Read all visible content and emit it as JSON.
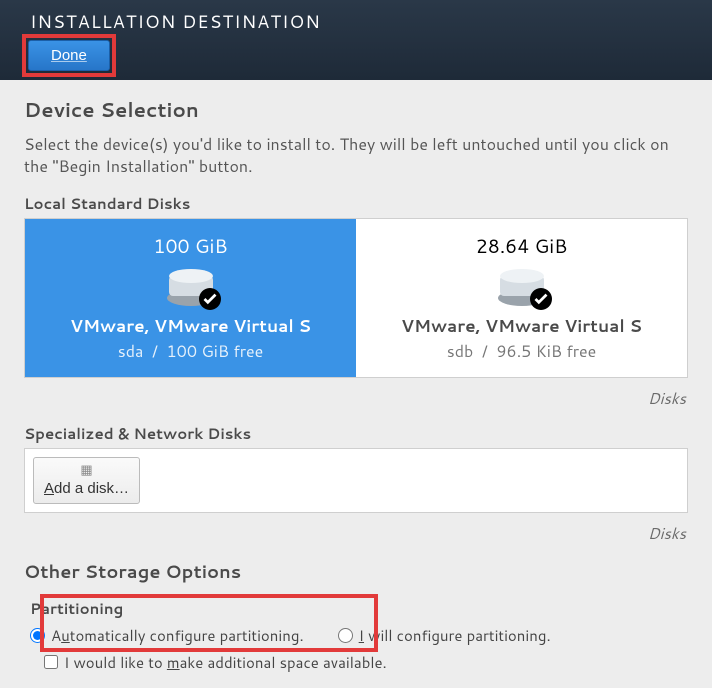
{
  "header": {
    "title": "INSTALLATION DESTINATION",
    "done_label": "Done"
  },
  "device_selection": {
    "title": "Device Selection",
    "instruction": "Select the device(s) you'd like to install to.  They will be left untouched until you click on the \"Begin Installation\" button.",
    "local_disks_label": "Local Standard Disks",
    "disks_note": "Disks",
    "disks": [
      {
        "size": "100 GiB",
        "label": "VMware, VMware Virtual S",
        "dev": "sda",
        "free": "100 GiB free",
        "selected": true
      },
      {
        "size": "28.64 GiB",
        "label": "VMware, VMware Virtual S",
        "dev": "sdb",
        "free": "96.5 KiB free",
        "selected": false
      }
    ],
    "specialized_label": "Specialized & Network Disks",
    "add_disk_label": "Add a disk…"
  },
  "other_storage": {
    "title": "Other Storage Options",
    "partitioning_label": "Partitioning",
    "auto_label": "Automatically configure partitioning.",
    "manual_label": "I will configure partitioning.",
    "extra_space_label": "I would like to make additional space available."
  }
}
